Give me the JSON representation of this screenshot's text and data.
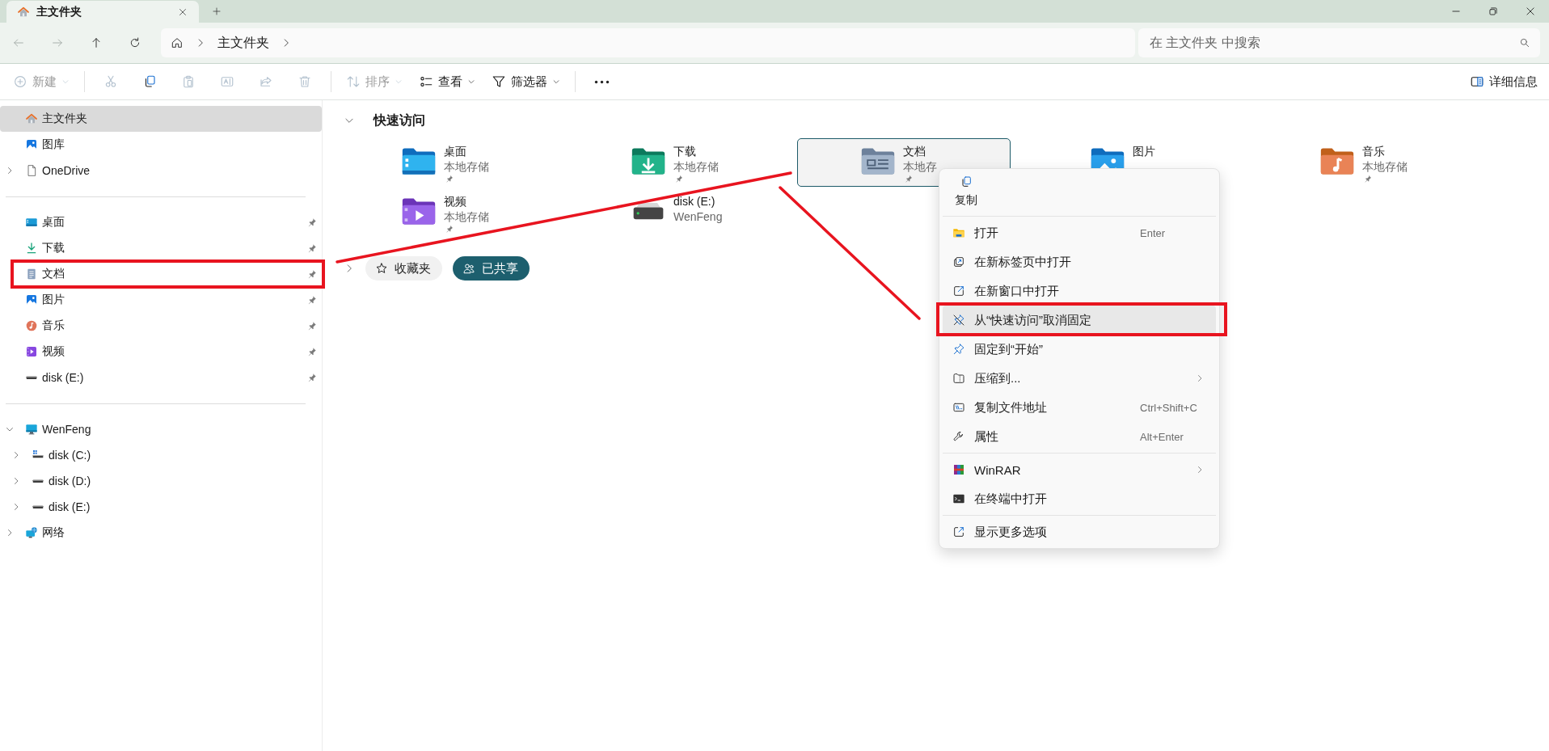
{
  "window": {
    "tab": {
      "title": "主文件夹"
    }
  },
  "nav": [
    {
      "disabled": true
    },
    {
      "disabled": true
    },
    {
      "disabled": false
    },
    {
      "disabled": false
    }
  ],
  "address": {
    "segments": [
      "主文件夹"
    ]
  },
  "search": {
    "placeholder": "在 主文件夹 中搜索"
  },
  "toolbar": {
    "items": [
      {
        "kind": "button",
        "label": "新建",
        "dropdown": true,
        "disabled": true
      },
      {
        "kind": "separator"
      },
      {
        "kind": "icon",
        "disabled": true
      },
      {
        "kind": "icon",
        "disabled": false
      },
      {
        "kind": "icon",
        "disabled": true
      },
      {
        "kind": "icon",
        "disabled": true
      },
      {
        "kind": "icon",
        "disabled": true
      },
      {
        "kind": "icon",
        "disabled": true
      },
      {
        "kind": "separator"
      },
      {
        "kind": "button",
        "label": "排序",
        "dropdown": true,
        "disabled": true
      },
      {
        "kind": "button",
        "label": "查看",
        "dropdown": true,
        "disabled": false
      },
      {
        "kind": "button",
        "label": "筛选器",
        "dropdown": true,
        "disabled": false
      },
      {
        "kind": "separator"
      },
      {
        "kind": "icon",
        "disabled": false
      }
    ],
    "details": {
      "label": "详细信息"
    }
  },
  "sidebar": {
    "sections": [
      {
        "items": [
          {
            "label": "主文件夹",
            "kind": "home",
            "selected": true,
            "pinned": false,
            "highlighted": false
          },
          {
            "label": "图库",
            "kind": "gallery",
            "selected": false,
            "pinned": false,
            "highlighted": false
          },
          {
            "label": "OneDrive",
            "kind": "file",
            "selected": false,
            "pinned": false,
            "highlighted": false,
            "expanded": false
          }
        ]
      },
      {
        "items": [
          {
            "label": "桌面",
            "kind": "desktop",
            "selected": false,
            "pinned": true,
            "highlighted": false
          },
          {
            "label": "下载",
            "kind": "download",
            "selected": false,
            "pinned": true,
            "highlighted": false
          },
          {
            "label": "文档",
            "kind": "document",
            "selected": false,
            "pinned": true,
            "highlighted": true
          },
          {
            "label": "图片",
            "kind": "gallery",
            "selected": false,
            "pinned": true,
            "highlighted": false
          },
          {
            "label": "音乐",
            "kind": "music",
            "selected": false,
            "pinned": true,
            "highlighted": false
          },
          {
            "label": "视频",
            "kind": "video",
            "selected": false,
            "pinned": true,
            "highlighted": false
          },
          {
            "label": "disk (E:)",
            "kind": "drive",
            "selected": false,
            "pinned": true,
            "highlighted": false
          }
        ]
      },
      {
        "items": [
          {
            "label": "WenFeng",
            "kind": "computer",
            "selected": false,
            "pinned": false,
            "highlighted": false,
            "expanded": true,
            "children": [
              {
                "label": "disk (C:)",
                "kind": "sysdrive",
                "selected": false,
                "pinned": false,
                "highlighted": false,
                "expanded": false
              },
              {
                "label": "disk (D:)",
                "kind": "drive",
                "selected": false,
                "pinned": false,
                "highlighted": false,
                "expanded": false
              },
              {
                "label": "disk (E:)",
                "kind": "drive",
                "selected": false,
                "pinned": false,
                "highlighted": false,
                "expanded": false
              }
            ]
          },
          {
            "label": "网络",
            "kind": "network",
            "selected": false,
            "pinned": false,
            "highlighted": false,
            "expanded": false
          }
        ]
      }
    ]
  },
  "quick_access": {
    "title": "快速访问",
    "expanded": true,
    "tiles": [
      {
        "name": "桌面",
        "subtitle": "本地存储",
        "kind": "desktop",
        "pinned": true,
        "selected": false
      },
      {
        "name": "下载",
        "subtitle": "本地存储",
        "kind": "download",
        "pinned": true,
        "selected": false
      },
      {
        "name": "文档",
        "subtitle": "本地存",
        "kind": "document",
        "pinned": true,
        "selected": true
      },
      {
        "name": "图片",
        "kind": "picture",
        "pinned": false,
        "selected": false
      },
      {
        "name": "音乐",
        "subtitle": "本地存储",
        "kind": "music",
        "pinned": true,
        "selected": false
      },
      {
        "name": "视频",
        "subtitle": "本地存储",
        "kind": "video",
        "pinned": true,
        "selected": false
      },
      {
        "name": "disk (E:)",
        "subtitle": "WenFeng",
        "kind": "drive",
        "pinned": false,
        "selected": false
      }
    ]
  },
  "chips_row": {
    "expanded": false,
    "chips": [
      {
        "label": "收藏夹",
        "selected": false
      },
      {
        "label": "已共享",
        "selected": true
      }
    ]
  },
  "context_menu": {
    "quick_actions": [
      {
        "label": "复制"
      }
    ],
    "groups": [
      {
        "items": [
          {
            "label": "打开",
            "kind": "open",
            "shortcut": "Enter",
            "submenu": false,
            "hovered": false,
            "highlighted": false
          },
          {
            "label": "在新标签页中打开",
            "kind": "newtab",
            "submenu": false,
            "hovered": false,
            "highlighted": false
          },
          {
            "label": "在新窗口中打开",
            "kind": "newwin",
            "submenu": false,
            "hovered": false,
            "highlighted": false
          },
          {
            "label": "从“快速访问”取消固定",
            "kind": "unpin",
            "submenu": false,
            "hovered": true,
            "highlighted": true
          },
          {
            "label": "固定到“开始”",
            "kind": "pin",
            "submenu": false,
            "hovered": false,
            "highlighted": false
          },
          {
            "label": "压缩到...",
            "kind": "zip",
            "submenu": true,
            "hovered": false,
            "highlighted": false
          },
          {
            "label": "复制文件地址",
            "kind": "path",
            "shortcut": "Ctrl+Shift+C",
            "submenu": false,
            "hovered": false,
            "highlighted": false
          },
          {
            "label": "属性",
            "kind": "properties",
            "shortcut": "Alt+Enter",
            "submenu": false,
            "hovered": false,
            "highlighted": false
          }
        ]
      },
      {
        "items": [
          {
            "label": "WinRAR",
            "kind": "archive",
            "submenu": true,
            "hovered": false,
            "highlighted": false
          },
          {
            "label": "在终端中打开",
            "kind": "terminal",
            "submenu": false,
            "hovered": false,
            "highlighted": false
          }
        ]
      },
      {
        "items": [
          {
            "label": "显示更多选项",
            "kind": "more",
            "submenu": false,
            "hovered": false,
            "highlighted": false
          }
        ]
      }
    ]
  },
  "annotations": [
    {
      "kind": "connector"
    },
    {
      "kind": "connector"
    }
  ]
}
